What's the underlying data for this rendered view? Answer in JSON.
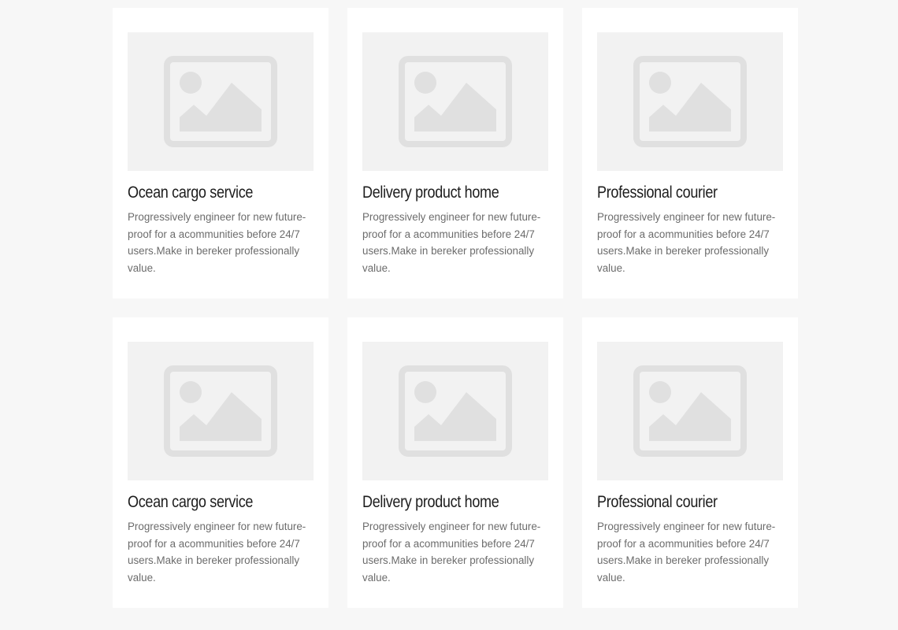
{
  "cards": [
    {
      "title": "Ocean cargo service",
      "description": "Progressively engineer for new future-proof for a acommunities before 24/7 users.Make in bereker professionally value.",
      "image_icon": "image-placeholder-icon"
    },
    {
      "title": "Delivery product home",
      "description": "Progressively engineer for new future-proof for a acommunities before 24/7 users.Make in bereker professionally value.",
      "image_icon": "image-placeholder-icon"
    },
    {
      "title": "Professional courier",
      "description": "Progressively engineer for new future-proof for a acommunities before 24/7 users.Make in bereker professionally value.",
      "image_icon": "image-placeholder-icon"
    },
    {
      "title": "Ocean cargo service",
      "description": "Progressively engineer for new future-proof for a acommunities before 24/7 users.Make in bereker professionally value.",
      "image_icon": "image-placeholder-icon"
    },
    {
      "title": "Delivery product home",
      "description": "Progressively engineer for new future-proof for a acommunities before 24/7 users.Make in bereker professionally value.",
      "image_icon": "image-placeholder-icon"
    },
    {
      "title": "Professional courier",
      "description": "Progressively engineer for new future-proof for a acommunities before 24/7 users.Make in bereker professionally value.",
      "image_icon": "image-placeholder-icon"
    }
  ],
  "colors": {
    "page_background": "#f7f7f7",
    "card_background": "#ffffff",
    "placeholder_background": "#f2f2f2",
    "placeholder_icon": "#e0e0e0",
    "title": "#1d1d1d",
    "text": "#6c6c6c"
  }
}
